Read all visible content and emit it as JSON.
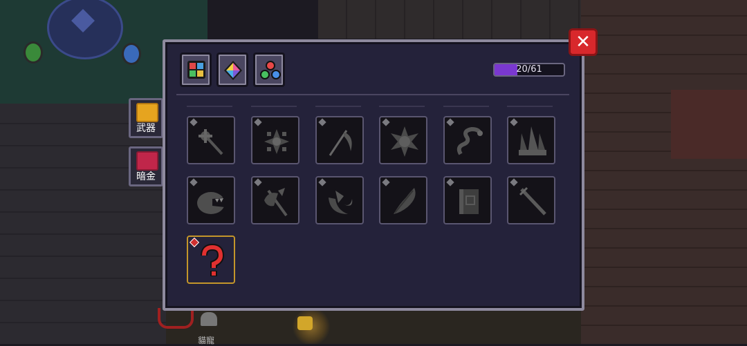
{
  "side_tabs": [
    {
      "label": "武器",
      "icon": "sword-emblem-icon",
      "active": true
    },
    {
      "label": "暗金",
      "icon": "dark-gold-icon",
      "active": false
    }
  ],
  "filters": [
    {
      "icon": "grid-quadrants-icon"
    },
    {
      "icon": "rainbow-gem-icon"
    },
    {
      "icon": "colored-orbs-icon"
    }
  ],
  "progress": {
    "text": "20/61",
    "collected": 20,
    "total": 61
  },
  "close": {
    "label": "✕"
  },
  "items": [
    {
      "icon": "mace-weapon-icon",
      "discovered": false
    },
    {
      "icon": "shuriken-weapon-icon",
      "discovered": false
    },
    {
      "icon": "scythe-weapon-icon",
      "discovered": false
    },
    {
      "icon": "spiked-star-weapon-icon",
      "discovered": false
    },
    {
      "icon": "serpent-whip-weapon-icon",
      "discovered": false
    },
    {
      "icon": "ship-blades-weapon-icon",
      "discovered": false
    },
    {
      "icon": "chomper-weapon-icon",
      "discovered": false
    },
    {
      "icon": "axe-weapon-icon",
      "discovered": false
    },
    {
      "icon": "claw-weapon-icon",
      "discovered": false
    },
    {
      "icon": "feather-blade-weapon-icon",
      "discovered": false
    },
    {
      "icon": "spellbook-weapon-icon",
      "discovered": false
    },
    {
      "icon": "sword-weapon-icon",
      "discovered": false
    },
    {
      "icon": "question-mark-icon",
      "discovered": true
    }
  ],
  "colors": {
    "accent": "#7a38d0",
    "found_border": "#c4962a",
    "close": "#d8282c"
  },
  "background_labels": {
    "npc": "貓寵"
  }
}
